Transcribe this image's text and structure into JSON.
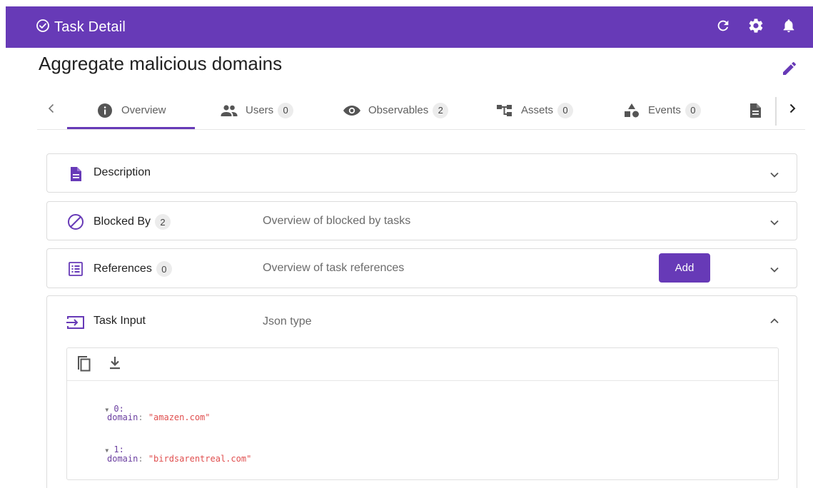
{
  "header": {
    "title": "Task Detail",
    "title_icon": "check-circle-icon",
    "actions": [
      "refresh-icon",
      "gear-icon",
      "bell-icon"
    ],
    "bg_color": "#673ab7"
  },
  "task": {
    "title": "Aggregate malicious domains"
  },
  "tabs": [
    {
      "label": "Overview",
      "icon": "info-icon",
      "count": null,
      "active": true
    },
    {
      "label": "Users",
      "icon": "users-icon",
      "count": "0"
    },
    {
      "label": "Observables",
      "icon": "eye-icon",
      "count": "2"
    },
    {
      "label": "Assets",
      "icon": "assets-icon",
      "count": "0"
    },
    {
      "label": "Events",
      "icon": "shapes-icon",
      "count": "0"
    },
    {
      "label": "",
      "icon": "document-icon",
      "count": null
    }
  ],
  "panels": {
    "description": {
      "title": "Description",
      "icon": "document-icon"
    },
    "blocked_by": {
      "title": "Blocked By",
      "count": "2",
      "subtitle": "Overview of blocked by tasks",
      "icon": "blocked-icon"
    },
    "references": {
      "title": "References",
      "count": "0",
      "subtitle": "Overview of task references",
      "add_label": "Add",
      "icon": "list-icon"
    },
    "task_input": {
      "title": "Task Input",
      "subtitle": "Json type",
      "icon": "input-icon"
    }
  },
  "json_viewer": {
    "toolbar": [
      "copy-icon",
      "download-icon"
    ],
    "items": [
      {
        "index": "0:",
        "key": "domain",
        "value": "\"amazen.com\""
      },
      {
        "index": "1:",
        "key": "domain",
        "value": "\"birdsarentreal.com\""
      }
    ]
  }
}
